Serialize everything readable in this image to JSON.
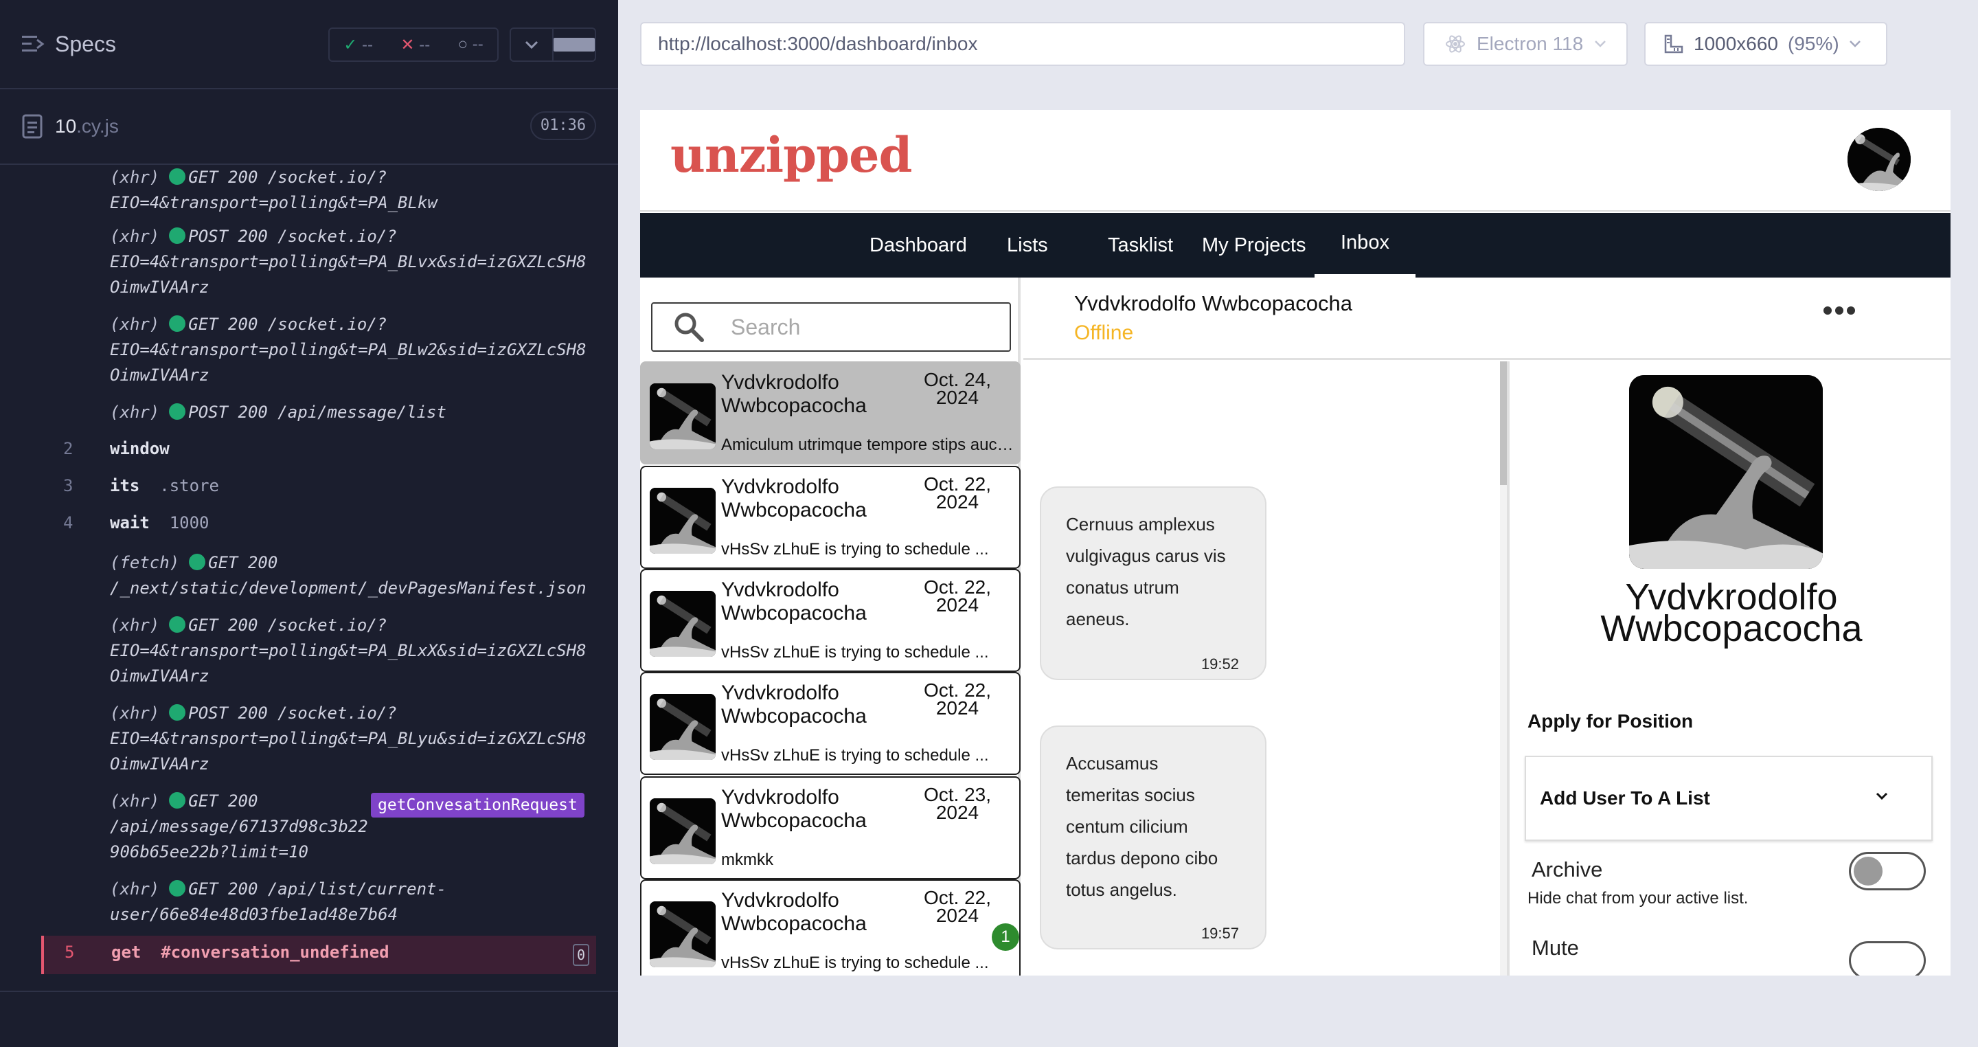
{
  "runner": {
    "specs_label": "Specs",
    "stats": {
      "passed": "--",
      "failed": "--",
      "pending": "--"
    },
    "spec_file": {
      "name": "10",
      "ext": ".cy.js",
      "duration": "01:36"
    },
    "log": [
      {
        "prefix": "(xhr)",
        "text": "GET 200 /socket.io/?",
        "cont": "EIO=4&transport=polling&t=PA_BLkw"
      },
      {
        "prefix": "(xhr)",
        "text": "POST 200 /socket.io/?",
        "cont": "EIO=4&transport=polling&t=PA_BLvx&sid=izGXZLcSH8",
        "cont2": "OimwIVAArz"
      },
      {
        "prefix": "(xhr)",
        "text": "GET 200 /socket.io/?",
        "cont": "EIO=4&transport=polling&t=PA_BLw2&sid=izGXZLcSH8",
        "cont2": "OimwIVAArz"
      },
      {
        "prefix": "(xhr)",
        "text": "POST 200 /api/message/list"
      },
      {
        "prefix": "(fetch)",
        "text": "GET 200",
        "cont": "/_next/static/development/_devPagesManifest.json"
      },
      {
        "prefix": "(xhr)",
        "text": "GET 200 /socket.io/?",
        "cont": "EIO=4&transport=polling&t=PA_BLxX&sid=izGXZLcSH8",
        "cont2": "OimwIVAArz"
      },
      {
        "prefix": "(xhr)",
        "text": "POST 200 /socket.io/?",
        "cont": "EIO=4&transport=polling&t=PA_BLyu&sid=izGXZLcSH8",
        "cont2": "OimwIVAArz"
      },
      {
        "prefix": "(xhr)",
        "text": "GET 200",
        "cont": "/api/message/67137d98c3b22",
        "cont2": "906b65ee22b?limit=10",
        "alias": "getConvesationRequest"
      },
      {
        "prefix": "(xhr)",
        "text": "GET 200 /api/list/current-",
        "cont": "user/66e84e48d03fbe1ad48e7b64"
      }
    ],
    "commands": [
      {
        "num": "2",
        "cmd": "window",
        "arg": ""
      },
      {
        "num": "3",
        "cmd": "its",
        "arg": ".store"
      },
      {
        "num": "4",
        "cmd": "wait",
        "arg": "1000"
      }
    ],
    "active_command": {
      "num": "5",
      "cmd": "get",
      "arg": "#conversation_undefined",
      "count": "0"
    }
  },
  "browser": {
    "url": "http://localhost:3000/dashboard/inbox",
    "browser_name": "Electron 118",
    "viewport": "1000x660",
    "zoom": "(95%)"
  },
  "app": {
    "logo": "unzipped",
    "nav": [
      "Dashboard",
      "Lists",
      "Tasklist",
      "My Projects",
      "Inbox"
    ],
    "active_nav": "Inbox",
    "search_placeholder": "Search",
    "conversations": [
      {
        "name": "Yvdvkrodolfo Wwbcopacocha",
        "date_line1": "Oct. 24,",
        "date_line2": "2024",
        "preview": "Amiculum utrimque tempore stips auctor...",
        "selected": true
      },
      {
        "name": "Yvdvkrodolfo Wwbcopacocha",
        "date_line1": "Oct. 22,",
        "date_line2": "2024",
        "preview": "vHsSv zLhuE is trying to schedule ...",
        "selected": false
      },
      {
        "name": "Yvdvkrodolfo Wwbcopacocha",
        "date_line1": "Oct. 22,",
        "date_line2": "2024",
        "preview": "vHsSv zLhuE is trying to schedule ...",
        "selected": false
      },
      {
        "name": "Yvdvkrodolfo Wwbcopacocha",
        "date_line1": "Oct. 22,",
        "date_line2": "2024",
        "preview": "vHsSv zLhuE is trying to schedule ...",
        "selected": false
      },
      {
        "name": "Yvdvkrodolfo Wwbcopacocha",
        "date_line1": "Oct. 23,",
        "date_line2": "2024",
        "preview": "mkmkk",
        "selected": false
      },
      {
        "name": "Yvdvkrodolfo Wwbcopacocha",
        "date_line1": "Oct. 22,",
        "date_line2": "2024",
        "preview": "vHsSv zLhuE is trying to schedule ...",
        "selected": false,
        "unread": "1"
      }
    ],
    "chat": {
      "name": "Yvdvkrodolfo Wwbcopacocha",
      "status": "Offline",
      "messages": [
        {
          "lines": [
            "Cernuus amplexus",
            "vulgivagus carus vis",
            "conatus utrum",
            "aeneus."
          ],
          "time": "19:52"
        },
        {
          "lines": [
            "Accusamus",
            "temeritas socius",
            "centum cilicium",
            "tardus depono cibo",
            "totus angelus."
          ],
          "time": "19:57"
        }
      ]
    },
    "profile": {
      "name_line1": "Yvdvkrodolfo",
      "name_line2": "Wwbcopacocha",
      "apply_label": "Apply for Position",
      "add_list_label": "Add User To A List",
      "archive_label": "Archive",
      "archive_desc": "Hide chat from your active list.",
      "archive_on": false,
      "mute_label": "Mute"
    }
  },
  "colors": {
    "runner_bg": "#1b1e2e",
    "pass": "#1fa971",
    "fail": "#e45770",
    "alias": "#7f43c9",
    "logo": "#d9534f",
    "nav_bg": "#121a26",
    "offline": "#f5b524",
    "unread_badge": "#2e8b2e"
  }
}
